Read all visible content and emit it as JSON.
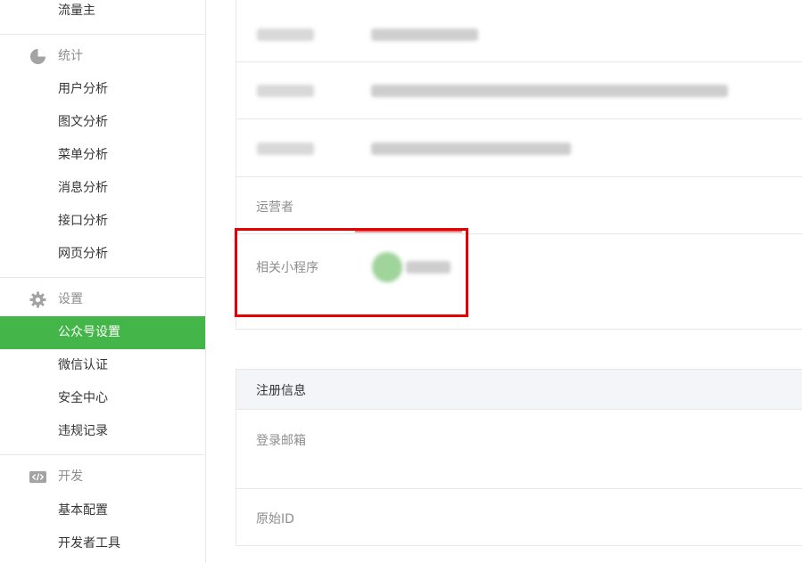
{
  "sidebar": {
    "top_item": "流量主",
    "groups": [
      {
        "title": "统计",
        "icon": "pie-chart-icon",
        "items": [
          "用户分析",
          "图文分析",
          "菜单分析",
          "消息分析",
          "接口分析",
          "网页分析"
        ]
      },
      {
        "title": "设置",
        "icon": "gear-icon",
        "items": [
          "公众号设置",
          "微信认证",
          "安全中心",
          "违规记录"
        ]
      },
      {
        "title": "开发",
        "icon": "code-icon",
        "items": [
          "基本配置",
          "开发者工具"
        ]
      }
    ],
    "active_item": "公众号设置"
  },
  "main": {
    "account_rows": [
      {
        "label": "运营者"
      },
      {
        "label": "相关小程序"
      }
    ],
    "registration": {
      "title": "注册信息",
      "rows": [
        {
          "label": "登录邮箱"
        },
        {
          "label": "原始ID"
        }
      ]
    }
  },
  "colors": {
    "accent": "#44b549",
    "highlight": "#e60000"
  }
}
